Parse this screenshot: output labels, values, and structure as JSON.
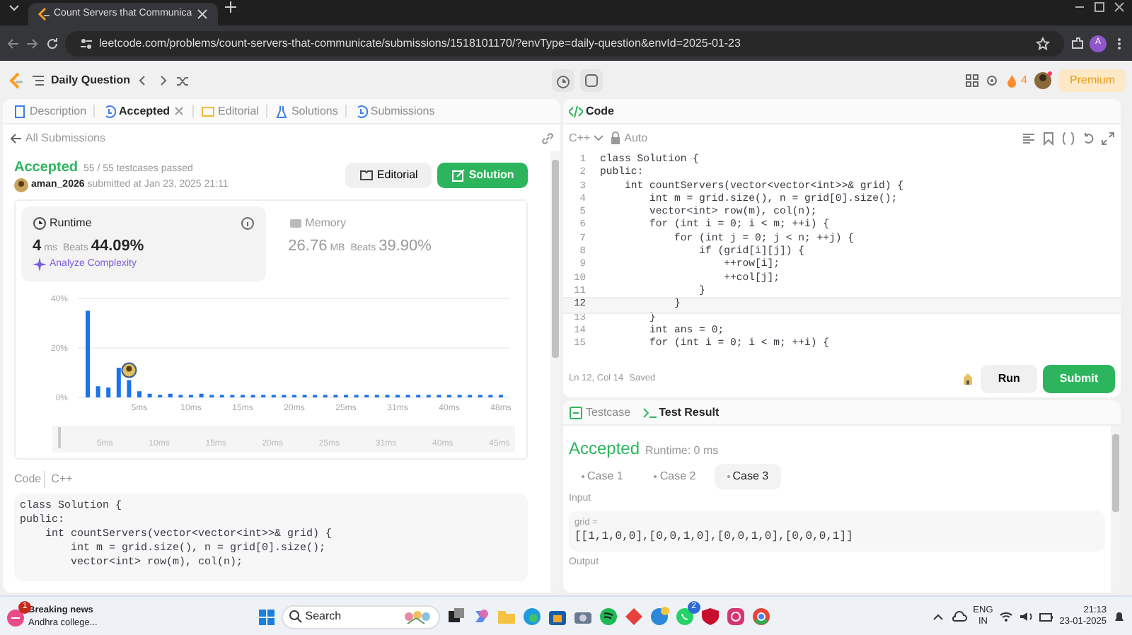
{
  "browser": {
    "tab_title": "Count Servers that Communica",
    "url": "leetcode.com/problems/count-servers-that-communicate/submissions/1518101170/?envType=daily-question&envId=2025-01-23",
    "profile_initial": "A"
  },
  "topnav": {
    "title": "Daily Question",
    "streak": "4",
    "premium": "Premium"
  },
  "left_tabs": [
    {
      "label": "Description",
      "selected": false,
      "closable": false
    },
    {
      "label": "Accepted",
      "selected": true,
      "closable": true
    },
    {
      "label": "Editorial",
      "selected": false,
      "closable": false
    },
    {
      "label": "Solutions",
      "selected": false,
      "closable": false
    },
    {
      "label": "Submissions",
      "selected": false,
      "closable": false
    }
  ],
  "back_link": "All Submissions",
  "submission": {
    "status": "Accepted",
    "testcases": "55 / 55 testcases passed",
    "user": "aman_2026",
    "submitted": "submitted at Jan 23, 2025 21:11",
    "editorial": "Editorial",
    "solution": "Solution"
  },
  "stats": [
    {
      "label": "Runtime",
      "value": "4",
      "unit": "ms",
      "beats_label": "Beats",
      "beats": "44.09%",
      "selected": true,
      "analyze": "Analyze Complexity"
    },
    {
      "label": "Memory",
      "value": "26.76",
      "unit": "MB",
      "beats_label": "Beats",
      "beats": "39.90%",
      "selected": false
    }
  ],
  "chart_data": {
    "type": "bar",
    "values": [
      35,
      4.5,
      4,
      12,
      7,
      2.5,
      1.5,
      1,
      1.5,
      1,
      1,
      1.5,
      1,
      1,
      1,
      1,
      1,
      1,
      1,
      1,
      1,
      1,
      1,
      1,
      1,
      1,
      1,
      1,
      1,
      1,
      1,
      1,
      1,
      1,
      1,
      1,
      1,
      1,
      1,
      1,
      1
    ],
    "ylim": [
      0,
      40
    ],
    "yticks": [
      {
        "value": 0,
        "label": "0%"
      },
      {
        "value": 20,
        "label": "20%"
      },
      {
        "value": 40,
        "label": "40%"
      }
    ]
  },
  "x_axis_labels": [
    "5ms",
    "10ms",
    "15ms",
    "20ms",
    "25ms",
    "31ms",
    "40ms",
    "48ms"
  ],
  "overview_labels": [
    "5ms",
    "10ms",
    "15ms",
    "20ms",
    "25ms",
    "31ms",
    "40ms",
    "45ms"
  ],
  "code_header": {
    "label": "Code",
    "language": "C++"
  },
  "submitted_code": [
    "class Solution {",
    "public:",
    "    int countServers(vector<vector<int>>& grid) {",
    "        int m = grid.size(), n = grid[0].size();",
    "        vector<int> row(m), col(n);"
  ],
  "editor": {
    "title": "Code",
    "language": "C++",
    "mode": "Auto",
    "lines": [
      {
        "number": "1",
        "text": "class Solution {",
        "current": false
      },
      {
        "number": "2",
        "text": "public:",
        "current": false
      },
      {
        "number": "3",
        "text": "    int countServers(vector<vector<int>>& grid) {",
        "current": false
      },
      {
        "number": "4",
        "text": "        int m = grid.size(), n = grid[0].size();",
        "current": false
      },
      {
        "number": "5",
        "text": "        vector<int> row(m), col(n);",
        "current": false
      },
      {
        "number": "6",
        "text": "        for (int i = 0; i < m; ++i) {",
        "current": false
      },
      {
        "number": "7",
        "text": "            for (int j = 0; j < n; ++j) {",
        "current": false
      },
      {
        "number": "8",
        "text": "                if (grid[i][j]) {",
        "current": false
      },
      {
        "number": "9",
        "text": "                    ++row[i];",
        "current": false
      },
      {
        "number": "10",
        "text": "                    ++col[j];",
        "current": false
      },
      {
        "number": "11",
        "text": "                }",
        "current": false
      },
      {
        "number": "12",
        "text": "            }",
        "current": true
      },
      {
        "number": "13",
        "text": "        }",
        "current": false
      },
      {
        "number": "14",
        "text": "        int ans = 0;",
        "current": false
      },
      {
        "number": "15",
        "text": "        for (int i = 0; i < m; ++i) {",
        "current": false
      }
    ],
    "cursor": "Ln 12, Col 14",
    "saved": "Saved",
    "run": "Run",
    "submit": "Submit"
  },
  "result_tabs": [
    {
      "label": "Testcase",
      "selected": false
    },
    {
      "label": "Test Result",
      "selected": true
    }
  ],
  "result": {
    "status": "Accepted",
    "runtime": "Runtime: 0 ms",
    "cases": [
      {
        "label": "Case 1",
        "selected": false
      },
      {
        "label": "Case 2",
        "selected": false
      },
      {
        "label": "Case 3",
        "selected": true
      }
    ],
    "input_label": "Input",
    "variable": "grid =",
    "value": "[[1,1,0,0],[0,0,1,0],[0,0,1,0],[0,0,0,1]]",
    "output_label": "Output"
  },
  "taskbar": {
    "news_badge": "1",
    "news_title": "Breaking news",
    "news_text": "Andhra college...",
    "search": "Search",
    "chat_badge": "2",
    "lang": "ENG",
    "region": "IN",
    "time": "21:13",
    "date": "23-01-2025"
  }
}
